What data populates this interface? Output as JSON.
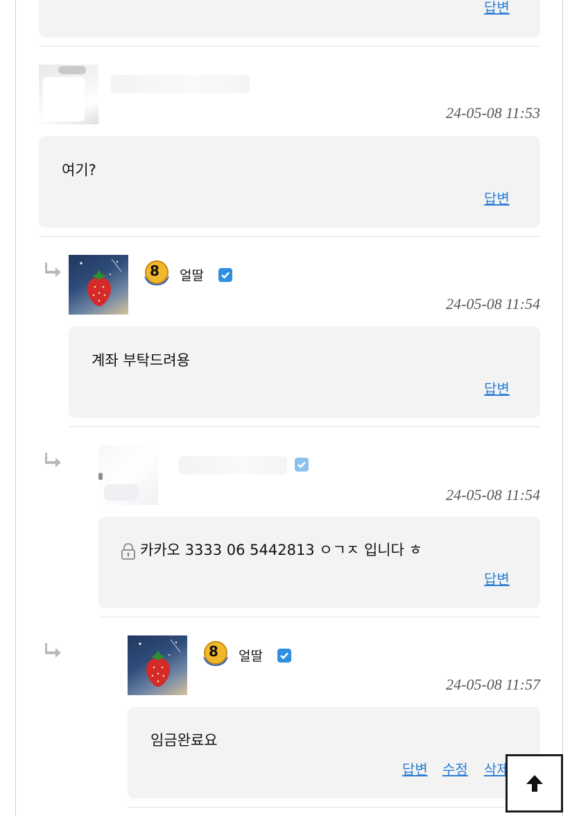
{
  "comments": [
    {
      "reply_label": "답변"
    },
    {
      "date": "24-05-08 11:53",
      "body": "여기?",
      "reply_label": "답변"
    },
    {
      "nickname": "얼딸",
      "level": "8",
      "date": "24-05-08 11:54",
      "body": "계좌 부탁드려용",
      "reply_label": "답변"
    },
    {
      "date": "24-05-08 11:54",
      "body": "카카오 3333 06 5442813 ㅇㄱㅈ 입니다 ㅎ",
      "reply_label": "답변",
      "secret_icon": "lock-icon"
    },
    {
      "nickname": "얼딸",
      "level": "8",
      "date": "24-05-08 11:57",
      "body": "임금완료요",
      "reply_label": "답변",
      "edit_label": "수정",
      "delete_label": "삭제"
    }
  ],
  "scroll_top_icon": "arrow-up-icon",
  "colors": {
    "link": "#2a7ed4",
    "box_bg": "#f3f3f3",
    "check": "#2f8ee0"
  }
}
